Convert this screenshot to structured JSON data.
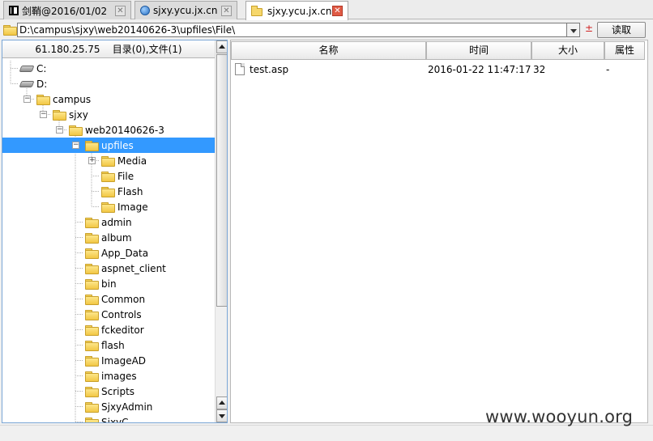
{
  "tabs": [
    {
      "label": "剑鞘@2016/01/02",
      "icon": "window-icon",
      "active": false
    },
    {
      "label": "sjxy.ycu.jx.cn",
      "icon": "globe-icon",
      "active": false
    },
    {
      "label": "sjxy.ycu.jx.cn",
      "icon": "folder-icon",
      "active": true
    }
  ],
  "address": {
    "path": "D:\\campus\\sjxy\\web20140626-3\\upfiles\\File\\",
    "plusminus": "±",
    "read_button": "读取"
  },
  "tree": {
    "header": "61.180.25.75    目录(0),文件(1)",
    "nodes": [
      {
        "label": "C:",
        "type": "drive",
        "depth": 0
      },
      {
        "label": "D:",
        "type": "drive",
        "depth": 0
      },
      {
        "label": "campus",
        "type": "folder",
        "depth": 1
      },
      {
        "label": "sjxy",
        "type": "folder",
        "depth": 2
      },
      {
        "label": "web20140626-3",
        "type": "folder",
        "depth": 3
      },
      {
        "label": "upfiles",
        "type": "folder",
        "depth": 4,
        "selected": true
      },
      {
        "label": "Media",
        "type": "folder",
        "depth": 5
      },
      {
        "label": "File",
        "type": "folder",
        "depth": 5
      },
      {
        "label": "Flash",
        "type": "folder",
        "depth": 5
      },
      {
        "label": "Image",
        "type": "folder",
        "depth": 5
      },
      {
        "label": "admin",
        "type": "folder",
        "depth": 4
      },
      {
        "label": "album",
        "type": "folder",
        "depth": 4
      },
      {
        "label": "App_Data",
        "type": "folder",
        "depth": 4
      },
      {
        "label": "aspnet_client",
        "type": "folder",
        "depth": 4
      },
      {
        "label": "bin",
        "type": "folder",
        "depth": 4
      },
      {
        "label": "Common",
        "type": "folder",
        "depth": 4
      },
      {
        "label": "Controls",
        "type": "folder",
        "depth": 4
      },
      {
        "label": "fckeditor",
        "type": "folder",
        "depth": 4
      },
      {
        "label": "flash",
        "type": "folder",
        "depth": 4
      },
      {
        "label": "ImageAD",
        "type": "folder",
        "depth": 4
      },
      {
        "label": "images",
        "type": "folder",
        "depth": 4
      },
      {
        "label": "Scripts",
        "type": "folder",
        "depth": 4
      },
      {
        "label": "SjxyAdmin",
        "type": "folder",
        "depth": 4
      },
      {
        "label": "SjxyC...",
        "type": "folder",
        "depth": 4
      }
    ]
  },
  "files": {
    "columns": [
      "名称",
      "时间",
      "大小",
      "属性"
    ],
    "rows": [
      {
        "name": "test.asp",
        "time": "2016-01-22 11:47:17",
        "size": "32",
        "attr": "-"
      }
    ]
  },
  "watermark": "www.wooyun.org",
  "colors": {
    "selection": "#3399ff",
    "close_active": "#e05a45",
    "folder": "#f2c744"
  }
}
